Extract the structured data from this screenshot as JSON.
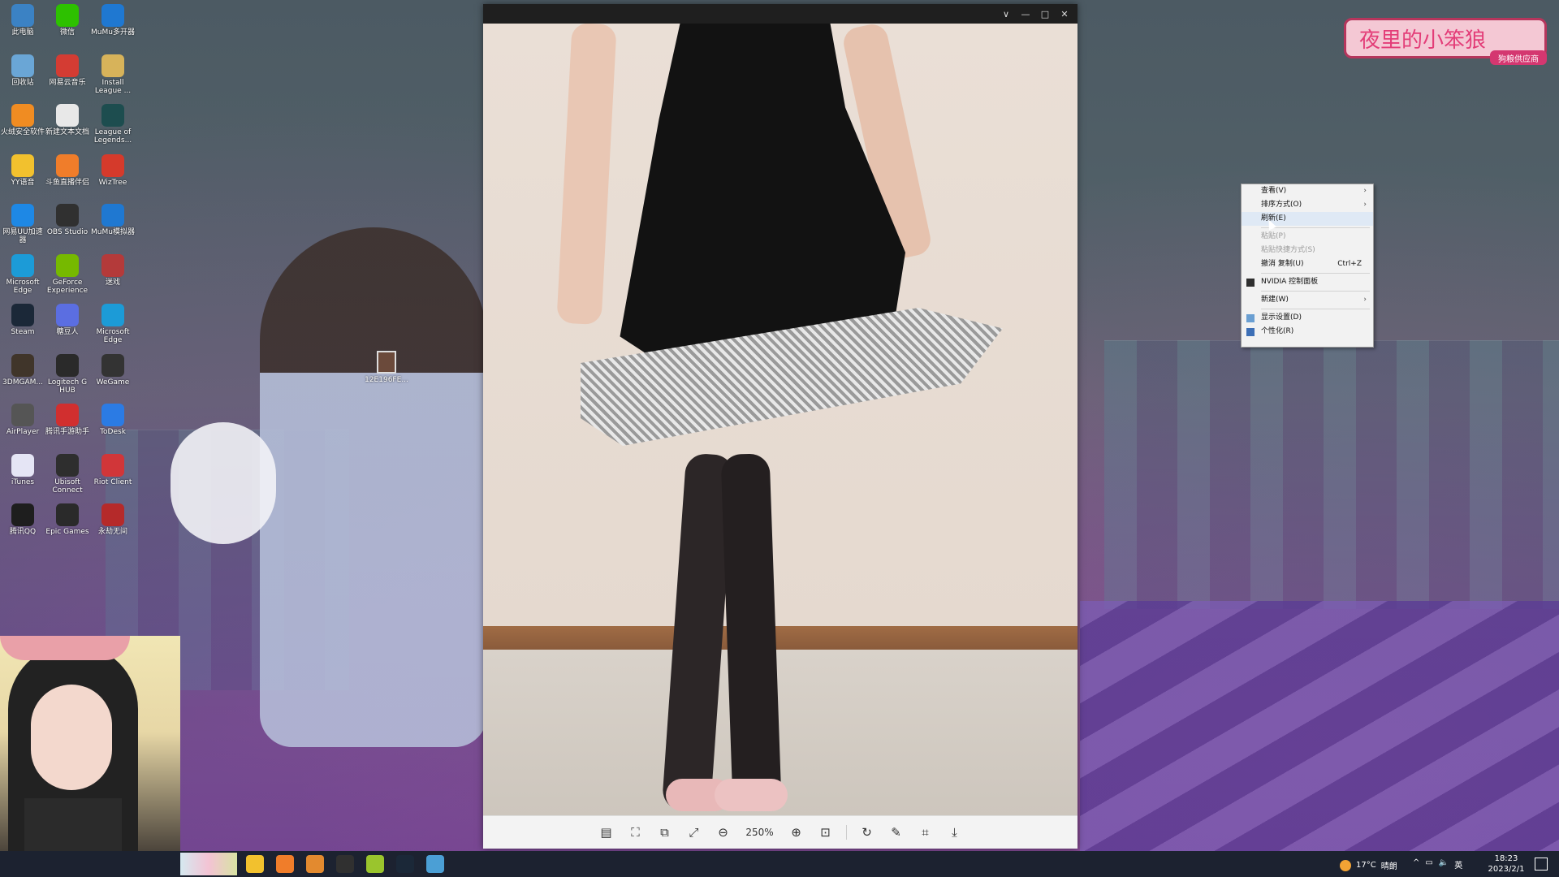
{
  "desktop_icons": [
    {
      "label": "此电脑",
      "icon": "computer-icon",
      "color": "#3b82c4"
    },
    {
      "label": "微信",
      "icon": "wechat-icon",
      "color": "#2dc100"
    },
    {
      "label": "MuMu多开器",
      "icon": "mumu-icon",
      "color": "#1f78d1"
    },
    {
      "label": "回收站",
      "icon": "recycle-bin-icon",
      "color": "#6aa6d6"
    },
    {
      "label": "网易云音乐",
      "icon": "netease-music-icon",
      "color": "#d43c33"
    },
    {
      "label": "Install League ...",
      "icon": "folder-icon",
      "color": "#d7b35a"
    },
    {
      "label": "火绒安全软件",
      "icon": "huorong-icon",
      "color": "#f08c22"
    },
    {
      "label": "新建文本文档",
      "icon": "text-file-icon",
      "color": "#e8e8e8"
    },
    {
      "label": "League of Legends...",
      "icon": "league-icon",
      "color": "#1d4d4f"
    },
    {
      "label": "YY语音",
      "icon": "yy-icon",
      "color": "#f2c12e"
    },
    {
      "label": "斗鱼直播伴侣",
      "icon": "douyu-icon",
      "color": "#f07d2a"
    },
    {
      "label": "WizTree",
      "icon": "wiztree-icon",
      "color": "#d53a2b"
    },
    {
      "label": "网易UU加速器",
      "icon": "uu-icon",
      "color": "#1e88e5"
    },
    {
      "label": "OBS Studio",
      "icon": "obs-icon",
      "color": "#303030"
    },
    {
      "label": "MuMu模拟器",
      "icon": "mumu-emulator-icon",
      "color": "#1f78d1"
    },
    {
      "label": "Microsoft Edge",
      "icon": "edge-icon",
      "color": "#1c9bd7"
    },
    {
      "label": "GeForce Experience",
      "icon": "geforce-icon",
      "color": "#76b900"
    },
    {
      "label": "迷戏",
      "icon": "game-icon",
      "color": "#b43a3a"
    },
    {
      "label": "Steam",
      "icon": "steam-icon",
      "color": "#1b2838"
    },
    {
      "label": "糖豆人",
      "icon": "fallguys-icon",
      "color": "#5b6ee1"
    },
    {
      "label": "Microsoft Edge",
      "icon": "edge-icon",
      "color": "#1c9bd7"
    },
    {
      "label": "3DMGAM...",
      "icon": "3dm-icon",
      "color": "#40352a"
    },
    {
      "label": "Logitech G HUB",
      "icon": "logitech-icon",
      "color": "#2a2a2a"
    },
    {
      "label": "WeGame",
      "icon": "wegame-icon",
      "color": "#333333"
    },
    {
      "label": "AirPlayer",
      "icon": "airplayer-icon",
      "color": "#555555"
    },
    {
      "label": "腾讯手游助手",
      "icon": "tencent-assistant-icon",
      "color": "#d12f2f"
    },
    {
      "label": "ToDesk",
      "icon": "todesk-icon",
      "color": "#2b7be4"
    },
    {
      "label": "iTunes",
      "icon": "itunes-icon",
      "color": "#e5e5f5"
    },
    {
      "label": "Ubisoft Connect",
      "icon": "ubisoft-icon",
      "color": "#2e2e2e"
    },
    {
      "label": "Riot Client",
      "icon": "riot-icon",
      "color": "#d13639"
    },
    {
      "label": "腾讯QQ",
      "icon": "qq-icon",
      "color": "#1e1e1e"
    },
    {
      "label": "Epic Games",
      "icon": "epic-icon",
      "color": "#2a2a2a"
    },
    {
      "label": "永劫无间",
      "icon": "naraka-icon",
      "color": "#b52a2a"
    }
  ],
  "free_icon": {
    "label": "12E196FE...",
    "icon": "image-file-icon"
  },
  "viewer": {
    "title_buttons": [
      "∨",
      "—",
      "□",
      "✕"
    ],
    "toolbar": {
      "zoom": "250%",
      "tools": [
        "fit-window-icon",
        "screenshot-icon",
        "compare-icon",
        "fullscreen-icon",
        "zoom-out-icon",
        "zoom-in-icon",
        "actual-size-icon",
        "rotate-icon",
        "edit-icon",
        "crop-icon",
        "download-icon"
      ]
    }
  },
  "watermark": {
    "title": "夜里的小笨狼",
    "sub": "狗粮供应商"
  },
  "context_menu": {
    "items": [
      {
        "label": "查看(V)",
        "arrow": "›"
      },
      {
        "label": "排序方式(O)",
        "arrow": "›"
      },
      {
        "label": "刷新(E)",
        "hover": true
      },
      {
        "label": "粘贴(P)",
        "disabled": true
      },
      {
        "label": "粘贴快捷方式(S)",
        "disabled": true
      },
      {
        "label": "撤消 复制(U)",
        "shortcut": "Ctrl+Z"
      },
      {
        "label": "NVIDIA 控制面板",
        "icon": "nvidia-icon"
      },
      {
        "label": "新建(W)",
        "arrow": "›"
      },
      {
        "label": "显示设置(D)",
        "icon": "display-icon"
      },
      {
        "label": "个性化(R)",
        "icon": "personalize-icon"
      }
    ]
  },
  "taskbar": {
    "weather": {
      "temp": "17°C",
      "desc": "晴朗"
    },
    "sys": {
      "chevron": "^",
      "lang": "英"
    },
    "clock": {
      "time": "18:23",
      "date": "2023/2/1"
    },
    "apps": [
      {
        "icon": "yy-icon",
        "color": "#f2c12e"
      },
      {
        "icon": "douyu-icon",
        "color": "#f07d2a"
      },
      {
        "icon": "douyu-alt-icon",
        "color": "#e38a2f"
      },
      {
        "icon": "obs-icon",
        "color": "#303030"
      },
      {
        "icon": "geforce-icon",
        "color": "#9ac52d"
      },
      {
        "icon": "steam-icon",
        "color": "#1b2838"
      },
      {
        "icon": "browser-icon",
        "color": "#4b9fd5"
      }
    ]
  },
  "colors": {
    "taskbar_bg": "#1c2230",
    "menu_bg": "#f2f2f2",
    "watermark_pink": "#e33d78"
  }
}
